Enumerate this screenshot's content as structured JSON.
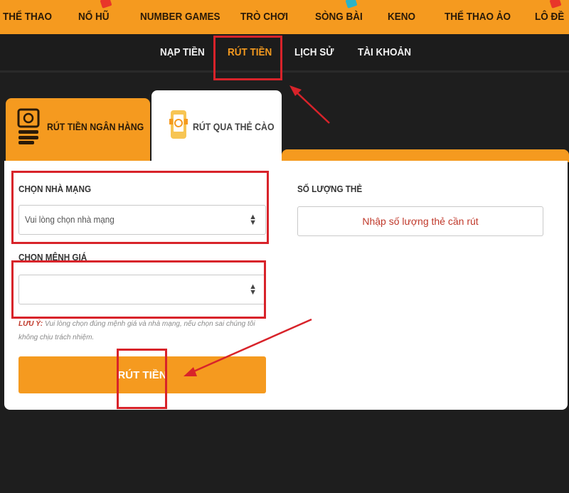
{
  "topnav": {
    "items": [
      "THỂ THAO",
      "NỔ HŨ",
      "NUMBER GAMES",
      "TRÒ CHƠI",
      "SÒNG BÀI",
      "KENO",
      "THỂ THAO ẢO",
      "LÔ ĐỀ"
    ]
  },
  "subnav": {
    "items": [
      "NẠP TIỀN",
      "RÚT TIỀN",
      "LỊCH SỬ",
      "TÀI KHOẢN"
    ],
    "active": "RÚT TIỀN"
  },
  "tabs": {
    "bank": "RÚT TIỀN NGÂN HÀNG",
    "card": "RÚT QUA THẺ CÀO"
  },
  "form": {
    "network_label": "CHỌN NHÀ MẠNG",
    "network_value": "Vui lòng chọn nhà mạng",
    "denomination_label": "CHỌN MỆNH GIÁ",
    "denomination_value": "",
    "quantity_label": "SỐ LƯỢNG THẺ",
    "quantity_placeholder": "Nhập số lượng thẻ cần rút",
    "note_label": "LƯU Ý:",
    "note_text": "Vui lòng chọn đúng mệnh giá và nhà mạng, nếu chọn sai chúng tôi không chịu trách nhiệm.",
    "submit_label": "RÚT TIỀN"
  },
  "colors": {
    "accent": "#f59a1f",
    "annotation": "#d8232a",
    "background": "#1e1e1e"
  }
}
